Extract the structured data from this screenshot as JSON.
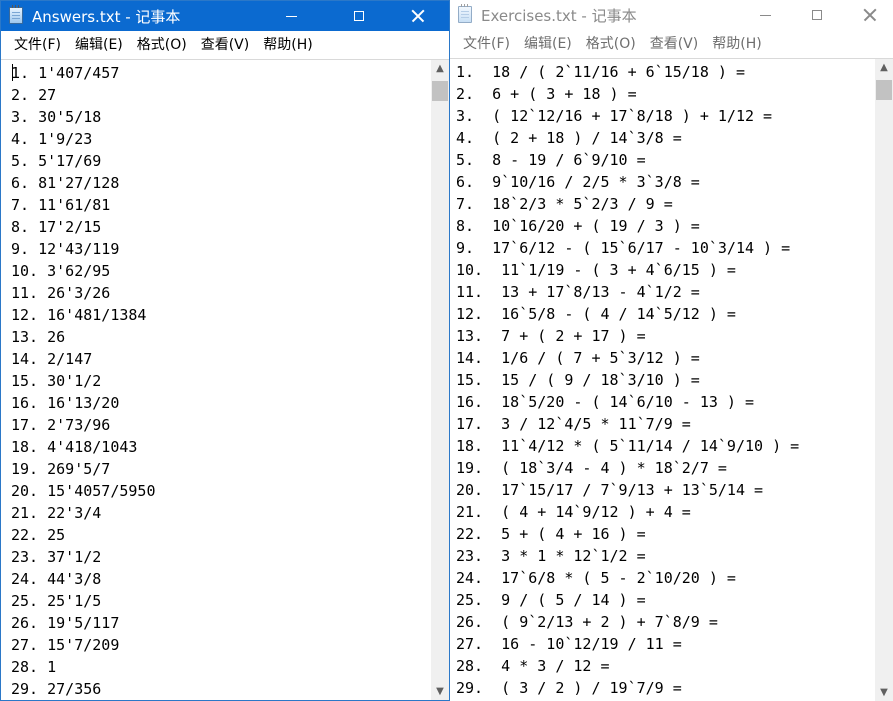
{
  "answers_window": {
    "title": "Answers.txt - 记事本",
    "menu": [
      "文件(F)",
      "编辑(E)",
      "格式(O)",
      "查看(V)",
      "帮助(H)"
    ],
    "lines": [
      "1. 1'407/457",
      "2. 27",
      "3. 30'5/18",
      "4. 1'9/23",
      "5. 5'17/69",
      "6. 81'27/128",
      "7. 11'61/81",
      "8. 17'2/15",
      "9. 12'43/119",
      "10. 3'62/95",
      "11. 26'3/26",
      "12. 16'481/1384",
      "13. 26",
      "14. 2/147",
      "15. 30'1/2",
      "16. 16'13/20",
      "17. 2'73/96",
      "18. 4'418/1043",
      "19. 269'5/7",
      "20. 15'4057/5950",
      "21. 22'3/4",
      "22. 25",
      "23. 37'1/2",
      "24. 44'3/8",
      "25. 25'1/5",
      "26. 19'5/117",
      "27. 15'7/209",
      "28. 1",
      "29. 27/356"
    ]
  },
  "exercises_window": {
    "title": "Exercises.txt - 记事本",
    "menu": [
      "文件(F)",
      "编辑(E)",
      "格式(O)",
      "查看(V)",
      "帮助(H)"
    ],
    "lines": [
      "1.  18 / ( 2`11/16 + 6`15/18 ) =",
      "2.  6 + ( 3 + 18 ) =",
      "3.  ( 12`12/16 + 17`8/18 ) + 1/12 =",
      "4.  ( 2 + 18 ) / 14`3/8 =",
      "5.  8 - 19 / 6`9/10 =",
      "6.  9`10/16 / 2/5 * 3`3/8 =",
      "7.  18`2/3 * 5`2/3 / 9 =",
      "8.  10`16/20 + ( 19 / 3 ) =",
      "9.  17`6/12 - ( 15`6/17 - 10`3/14 ) =",
      "10.  11`1/19 - ( 3 + 4`6/15 ) =",
      "11.  13 + 17`8/13 - 4`1/2 =",
      "12.  16`5/8 - ( 4 / 14`5/12 ) =",
      "13.  7 + ( 2 + 17 ) =",
      "14.  1/6 / ( 7 + 5`3/12 ) =",
      "15.  15 / ( 9 / 18`3/10 ) =",
      "16.  18`5/20 - ( 14`6/10 - 13 ) =",
      "17.  3 / 12`4/5 * 11`7/9 =",
      "18.  11`4/12 * ( 5`11/14 / 14`9/10 ) =",
      "19.  ( 18`3/4 - 4 ) * 18`2/7 =",
      "20.  17`15/17 / 7`9/13 + 13`5/14 =",
      "21.  ( 4 + 14`9/12 ) + 4 =",
      "22.  5 + ( 4 + 16 ) =",
      "23.  3 * 1 * 12`1/2 =",
      "24.  17`6/8 * ( 5 - 2`10/20 ) =",
      "25.  9 / ( 5 / 14 ) =",
      "26.  ( 9`2/13 + 2 ) + 7`8/9 =",
      "27.  16 - 10`12/19 / 11 =",
      "28.  4 * 3 / 12 =",
      "29.  ( 3 / 2 ) / 19`7/9 ="
    ]
  },
  "icons": {
    "app": "notepad-icon",
    "minimize": "minimize-icon",
    "maximize": "maximize-icon",
    "close": "close-icon",
    "scroll_up": "scroll-up-arrow-icon",
    "scroll_down": "scroll-down-arrow-icon"
  },
  "colors": {
    "active_titlebar": "#0b6ad0",
    "inactive_title_text": "#8a8a8a",
    "text": "#000000"
  }
}
